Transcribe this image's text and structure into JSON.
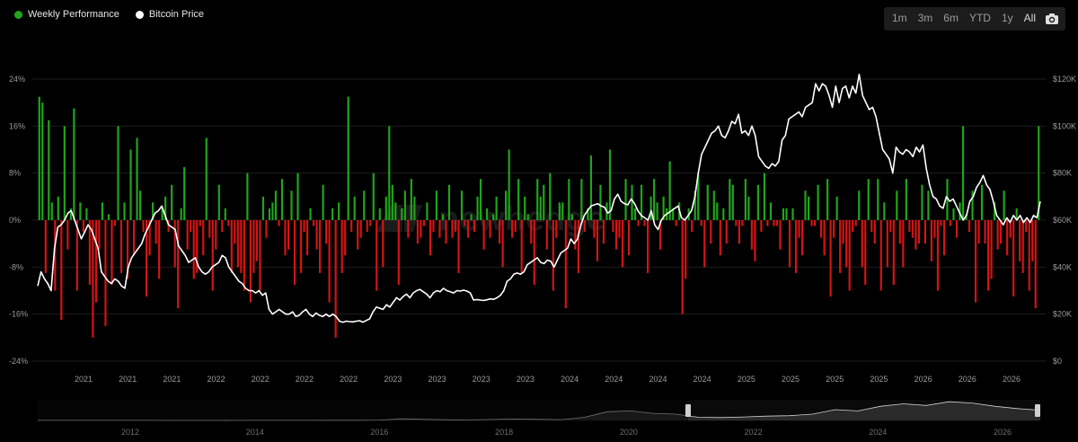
{
  "legend": {
    "weekly_label": "Weekly Performance",
    "price_label": "Bitcoin Price",
    "weekly_color": "#1fa61a",
    "price_color": "#ffffff"
  },
  "range_buttons": [
    {
      "label": "1m",
      "active": false
    },
    {
      "label": "3m",
      "active": false
    },
    {
      "label": "6m",
      "active": false
    },
    {
      "label": "YTD",
      "active": false
    },
    {
      "label": "1y",
      "active": false
    },
    {
      "label": "All",
      "active": true
    }
  ],
  "icons": {
    "camera": "camera-icon"
  },
  "watermark": "newhedge",
  "colors": {
    "positive": "#1fa61a",
    "negative": "#d41414",
    "price": "#ffffff",
    "grid": "#1e1e1e",
    "axis_text": "#9a9a9a"
  },
  "chart_data": {
    "type": "bar+line",
    "left_axis": {
      "ticks": [
        "24%",
        "16%",
        "8%",
        "0%",
        "-8%",
        "-16%",
        "-24%"
      ],
      "range": [
        -24,
        24
      ]
    },
    "right_axis": {
      "ticks": [
        "$120K",
        "$100K",
        "$80K",
        "$60K",
        "$40K",
        "$20K",
        "$0"
      ],
      "range": [
        0,
        120000
      ]
    },
    "x_tick_labels": [
      "2021",
      "2021",
      "2021",
      "2022",
      "2022",
      "2022",
      "2022",
      "2023",
      "2023",
      "2023",
      "2023",
      "2024",
      "2024",
      "2024",
      "2024",
      "2025",
      "2025",
      "2025",
      "2025",
      "2026",
      "2026",
      "2026"
    ],
    "navigator_tick_labels": [
      "2012",
      "2014",
      "2016",
      "2018",
      "2020",
      "2022",
      "2024",
      "2026"
    ],
    "series": [
      {
        "name": "Weekly Performance",
        "values": [
          21,
          20,
          -9,
          17,
          3,
          -12,
          4,
          -17,
          16,
          -5,
          2,
          19,
          -12,
          3,
          -2,
          2,
          -11,
          -20,
          -14,
          -5,
          3,
          -18,
          1,
          -11,
          -1,
          16,
          -9,
          3,
          -10,
          12,
          -6,
          14,
          5,
          -2,
          -13,
          -6,
          3,
          -4,
          -10,
          2,
          4,
          -2,
          6,
          -8,
          -15,
          2,
          9,
          -5,
          -2,
          -10,
          -9,
          -1,
          -6,
          14,
          -3,
          -12,
          -5,
          6,
          -2,
          2,
          -1,
          -9,
          -4,
          -8,
          -9,
          -12,
          8,
          -14,
          -9,
          -7,
          -12,
          4,
          -3,
          2,
          3,
          5,
          -1,
          7,
          -6,
          -5,
          5,
          -11,
          8,
          -9,
          -2,
          -6,
          2,
          -1,
          -5,
          -9,
          6,
          -4,
          -14,
          2,
          -20,
          3,
          -9,
          -6,
          21,
          -2,
          4,
          -5,
          -3,
          5,
          -2,
          -1,
          8,
          -12,
          2,
          -8,
          4,
          16,
          6,
          3,
          -11,
          2,
          5,
          -3,
          7,
          4,
          -4,
          -3,
          -1,
          3,
          -6,
          -2,
          5,
          -3,
          1,
          -4,
          6,
          -3,
          -2,
          -9,
          5,
          -1,
          -3,
          1,
          -2,
          4,
          7,
          -5,
          2,
          -3,
          1,
          4,
          -4,
          -8,
          5,
          12,
          -3,
          -2,
          7,
          -9,
          4,
          1,
          -4,
          -11,
          7,
          4,
          6,
          -5,
          8,
          -12,
          -3,
          3,
          3,
          -15,
          7,
          1,
          -5,
          -9,
          7,
          -2,
          2,
          11,
          -3,
          -7,
          6,
          -4,
          3,
          12,
          -2,
          -5,
          -3,
          -8,
          7,
          -6,
          6,
          2,
          -1,
          6,
          -1,
          -9,
          4,
          7,
          3,
          -5,
          4,
          2,
          10,
          2,
          -1,
          3,
          -16,
          -10,
          2,
          -2,
          5,
          8,
          -1,
          -8,
          6,
          -4,
          5,
          3,
          -6,
          2,
          -4,
          7,
          6,
          -1,
          -4,
          -1,
          7,
          4,
          -5,
          -7,
          6,
          -2,
          8,
          -1,
          3,
          -1,
          -1,
          -5,
          2,
          2,
          -8,
          2,
          -9,
          -3,
          -6,
          5,
          4,
          -1,
          -1,
          6,
          -3,
          -6,
          7,
          -13,
          -3,
          4,
          -9,
          -4,
          -8,
          -12,
          -2,
          -1,
          5,
          -8,
          -11,
          7,
          -2,
          -4,
          7,
          -12,
          3,
          -8,
          -2,
          -11,
          5,
          -4,
          -8,
          7,
          -2,
          -3,
          -5,
          -4,
          6,
          -4,
          5,
          -7,
          -3,
          -12,
          -1,
          -6,
          7,
          -1,
          2,
          -3,
          3,
          16,
          1,
          -2,
          5,
          -14,
          -4,
          6,
          -4,
          -12,
          -10,
          3,
          -5,
          -4,
          5,
          -6,
          -3,
          -13,
          2,
          -7,
          -9,
          -2,
          -12,
          -7,
          -15,
          16
        ]
      },
      {
        "name": "Bitcoin Price",
        "values": [
          32000,
          38000,
          35000,
          33000,
          30000,
          48000,
          57000,
          58000,
          60000,
          63000,
          64000,
          60000,
          56000,
          52000,
          55000,
          58000,
          56000,
          52000,
          48000,
          38000,
          36000,
          34000,
          33000,
          35000,
          34000,
          32000,
          31000,
          40000,
          44000,
          46000,
          48000,
          50000,
          54000,
          57000,
          60000,
          63000,
          64000,
          66000,
          62000,
          58000,
          57000,
          56000,
          49000,
          47000,
          45000,
          42000,
          43000,
          44000,
          40000,
          38000,
          37000,
          38000,
          40000,
          41000,
          42000,
          45000,
          44000,
          40000,
          38000,
          36000,
          34000,
          33000,
          31000,
          30000,
          30000,
          29000,
          30000,
          28000,
          29000,
          22000,
          20000,
          21000,
          22000,
          21000,
          20000,
          20000,
          21000,
          19000,
          19500,
          21000,
          22000,
          20000,
          19000,
          20500,
          19500,
          19000,
          20000,
          19000,
          20000,
          19000,
          17000,
          16500,
          17000,
          16800,
          16700,
          17000,
          17200,
          16600,
          17300,
          18000,
          21000,
          23000,
          22500,
          22000,
          24000,
          23000,
          25000,
          27000,
          26000,
          27500,
          28500,
          27000,
          29000,
          30000,
          30500,
          29500,
          28500,
          27000,
          29000,
          30000,
          29500,
          31000,
          30000,
          29500,
          29000,
          30000,
          29800,
          30200,
          29800,
          29000,
          26000,
          26200,
          26000,
          25800,
          26100,
          26500,
          26300,
          27000,
          28000,
          30000,
          34000,
          35000,
          37000,
          37500,
          37000,
          38000,
          41000,
          42000,
          43000,
          44000,
          42000,
          41500,
          43000,
          42500,
          40000,
          43000,
          46000,
          47000,
          48000,
          52000,
          50000,
          52000,
          58000,
          62000,
          64000,
          66000,
          66500,
          67000,
          66000,
          65500,
          63000,
          64000,
          69000,
          71000,
          68000,
          67000,
          66500,
          69000,
          67000,
          64000,
          62000,
          61000,
          60000,
          64000,
          58000,
          56000,
          60000,
          62000,
          63000,
          64000,
          65000,
          66000,
          61000,
          60000,
          62000,
          64000,
          70000,
          80000,
          88000,
          91000,
          94000,
          97000,
          98000,
          100000,
          96000,
          95000,
          98000,
          102000,
          101000,
          105000,
          97000,
          98000,
          96000,
          100000,
          96000,
          87000,
          85000,
          83000,
          82000,
          84000,
          83000,
          85000,
          94000,
          96000,
          103000,
          104000,
          105000,
          106000,
          104000,
          108000,
          109000,
          110000,
          118000,
          115000,
          118000,
          117000,
          113000,
          108000,
          117000,
          110000,
          116000,
          117000,
          112000,
          117000,
          114000,
          122000,
          113000,
          110000,
          107000,
          108000,
          104000,
          97000,
          90000,
          88000,
          86000,
          80000,
          91000,
          89000,
          88000,
          90000,
          89000,
          87000,
          91000,
          89000,
          92000,
          82000,
          75000,
          70000,
          69000,
          66000,
          65000,
          70000,
          68000,
          69000,
          66000,
          63000,
          60000,
          62000,
          68000,
          70000,
          74000,
          76000,
          79000,
          75000,
          73000,
          68000,
          62000,
          60000,
          58000,
          61000,
          59000,
          62000,
          60000,
          62000,
          59000,
          61000,
          59000,
          62000,
          61000,
          68000
        ]
      }
    ],
    "price_overview": [
      300,
      400,
      500,
      400,
      350,
      300,
      250,
      250,
      250,
      350,
      400,
      430,
      600,
      900,
      1000,
      2500,
      10000,
      7000,
      4000,
      3500,
      6500,
      9000,
      7000,
      5000,
      20000,
      55000,
      60000,
      45000,
      40000,
      20000,
      18000,
      22000,
      27000,
      30000,
      40000,
      68000,
      60000,
      90000,
      105000,
      95000,
      118000,
      110000,
      90000,
      75000,
      65000
    ]
  }
}
